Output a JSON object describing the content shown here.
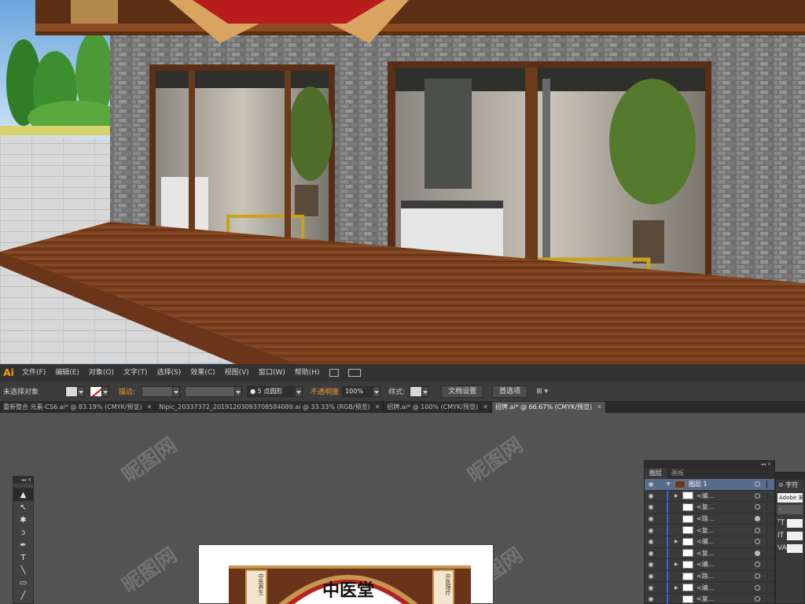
{
  "menubar": {
    "app_logo": "Ai",
    "items": [
      "文件(F)",
      "编辑(E)",
      "对象(O)",
      "文字(T)",
      "选择(S)",
      "效果(C)",
      "视图(V)",
      "窗口(W)",
      "帮助(H)"
    ]
  },
  "controlbar": {
    "selection_status": "未选择对象",
    "stroke_label": "描边:",
    "brush_value": "5 点圆形",
    "opacity_label": "不透明度",
    "opacity_value": "100%",
    "style_label": "样式:",
    "doc_setup_button": "文档设置",
    "preferences_button": "首选项"
  },
  "tabs": [
    {
      "label": "重新整合 元素-CS6.ai* @ 83.19% (CMYK/预览)",
      "active": false
    },
    {
      "label": "Nipic_20337372_20191203093708584089.ai @ 33.33% (RGB/预览)",
      "active": false
    },
    {
      "label": "招牌.ai* @ 100% (CMYK/预览)",
      "active": false
    },
    {
      "label": "招牌.ai* @ 66.67% (CMYK/预览)",
      "active": true
    }
  ],
  "tools": [
    "selection-tool",
    "direct-selection-tool",
    "magic-wand-tool",
    "lasso-tool",
    "pen-tool",
    "type-tool",
    "line-tool",
    "rectangle-tool",
    "brush-tool"
  ],
  "tool_glyphs": [
    "▲",
    "↖",
    "✱",
    "ↄ",
    "✒",
    "T",
    "╲",
    "▭",
    "╱"
  ],
  "layers_panel": {
    "tabs": [
      "图层",
      "画板"
    ],
    "main_layer": "图层 1",
    "rows": [
      {
        "name": "<编...",
        "expand": true,
        "circle_filled": false
      },
      {
        "name": "<复...",
        "expand": false,
        "circle_filled": false
      },
      {
        "name": "<路...",
        "expand": false,
        "circle_filled": true
      },
      {
        "name": "<复...",
        "expand": false,
        "circle_filled": false
      },
      {
        "name": "<编...",
        "expand": true,
        "circle_filled": false
      },
      {
        "name": "<复...",
        "expand": false,
        "circle_filled": true
      },
      {
        "name": "<编...",
        "expand": true,
        "circle_filled": false
      },
      {
        "name": "<路...",
        "expand": false,
        "circle_filled": false
      },
      {
        "name": "<编...",
        "expand": true,
        "circle_filled": false
      },
      {
        "name": "<复...",
        "expand": false,
        "circle_filled": false
      }
    ]
  },
  "character_panel": {
    "title": "字符",
    "font_field": "Adobe 宋",
    "style_field": "-"
  },
  "artboard": {
    "sign_title": "中医堂",
    "left_panel": "中医养生",
    "right_panel": "中医理疗"
  },
  "colors": {
    "wood": "#7a3f1e",
    "brick": "#7d7d7d",
    "accent_blue": "#2e6cd6",
    "ai_orange": "#ff9a00"
  }
}
